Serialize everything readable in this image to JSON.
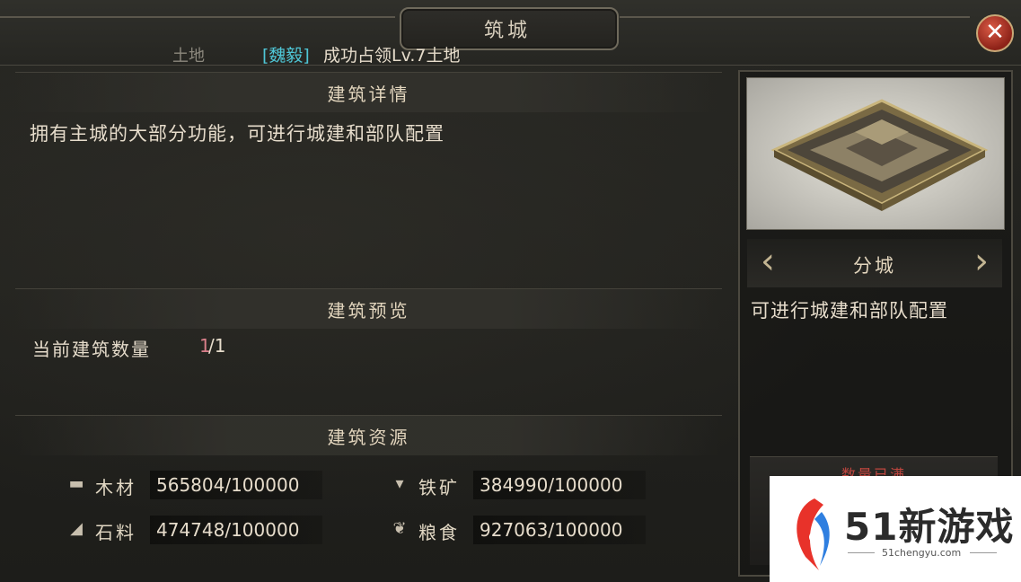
{
  "dialog": {
    "title": "筑城",
    "close_icon": "close-icon"
  },
  "news": {
    "land_label": "土地",
    "faction": "[魏毅]",
    "message": "成功占领Lv.7土地"
  },
  "details": {
    "header": "建筑详情",
    "description": "拥有主城的大部分功能，可进行城建和部队配置"
  },
  "preview_section": {
    "header": "建筑预览",
    "count_label": "当前建筑数量",
    "count_current": "1",
    "count_total": "/1"
  },
  "resources": {
    "header": "建筑资源",
    "items": [
      {
        "icon": "wood-icon",
        "name": "木材",
        "value": "565804/100000"
      },
      {
        "icon": "iron-icon",
        "name": "铁矿",
        "value": "384990/100000"
      },
      {
        "icon": "stone-icon",
        "name": "石料",
        "value": "474748/100000"
      },
      {
        "icon": "grain-icon",
        "name": "粮食",
        "value": "927063/100000"
      }
    ]
  },
  "building_card": {
    "image_icon": "city-fortress-image",
    "name": "分城",
    "description": "可进行城建和部队配置",
    "status_text": "数量已满"
  },
  "watermark": {
    "logo_text": "51新游戏",
    "site": "51chengyu.com"
  },
  "colors": {
    "faction": "#4fc6d6",
    "count_current": "#d97f8a",
    "close_button": "#b0342a"
  }
}
